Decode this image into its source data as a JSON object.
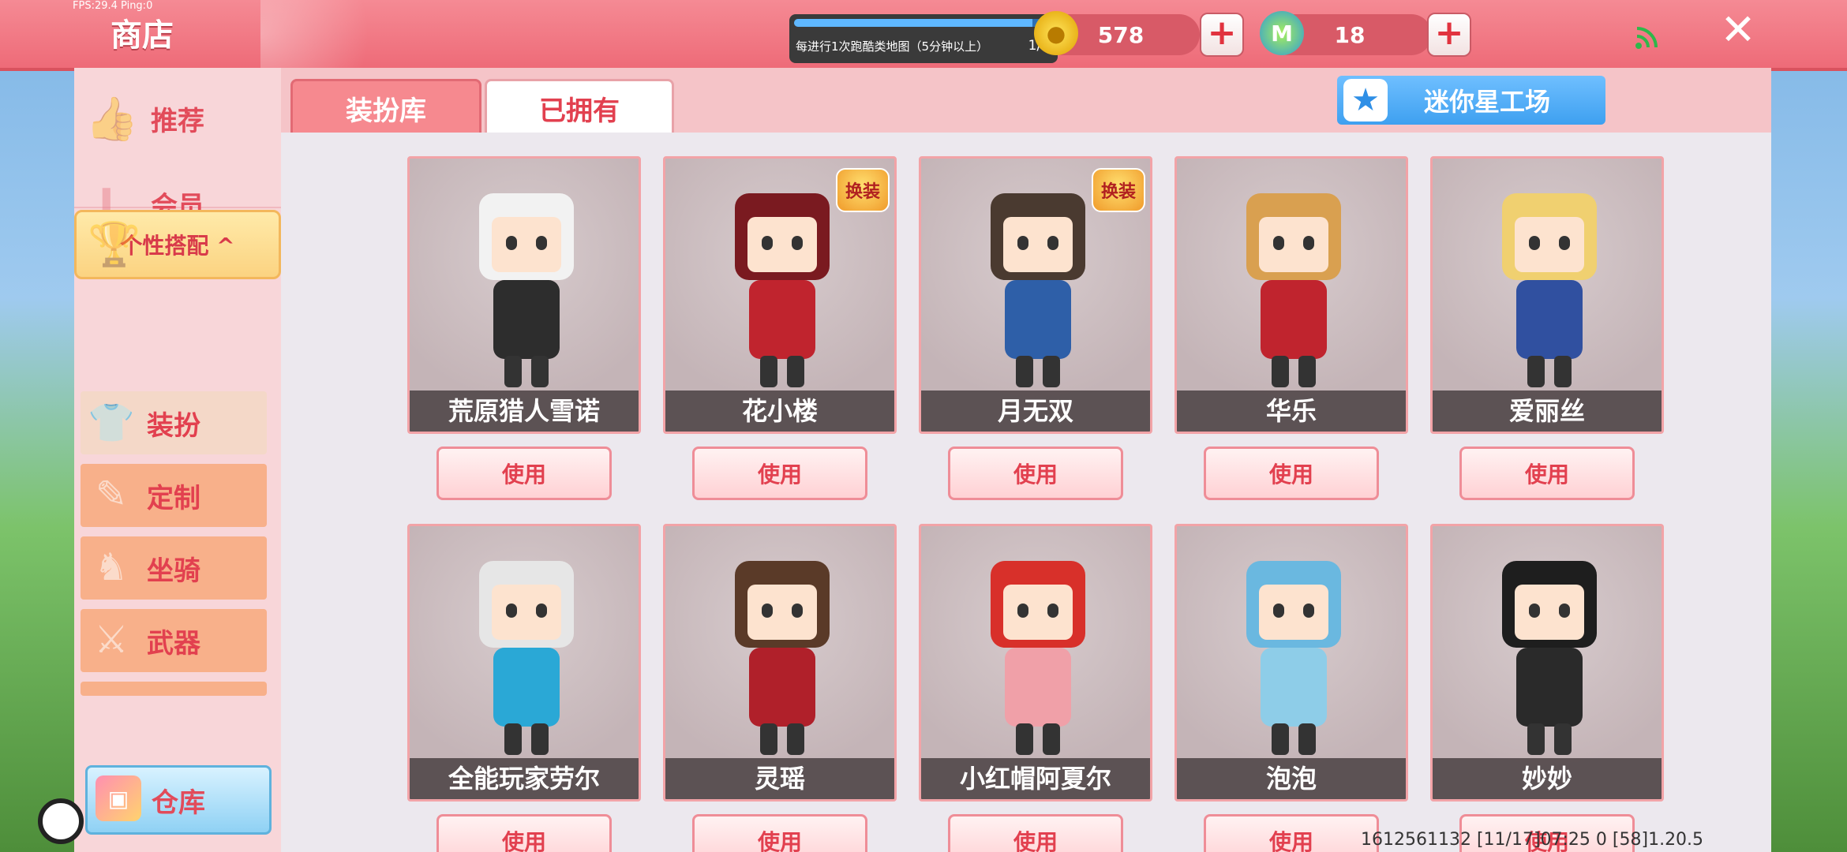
{
  "debug": {
    "fps": "FPS:29.4  Ping:0"
  },
  "header": {
    "title": "商店",
    "task": {
      "text": "每进行1次跑酷类地图（5分钟以上）",
      "count": "1/1",
      "progress": 0.92
    },
    "coins": {
      "value": "578"
    },
    "mini_coins": {
      "value": "18",
      "icon_label": "M"
    }
  },
  "colors": {
    "accent": "#ee6b78",
    "sidebar": "#f8d6d9",
    "panel": "#f5c4c8",
    "blue": "#3ea0f0"
  },
  "sidebar": {
    "items": [
      {
        "label": "推荐",
        "icon": "thumb-icon"
      },
      {
        "label": "会员",
        "icon": "vip-icon"
      },
      {
        "label": "个性搭配 ^",
        "icon": "trophy-icon"
      }
    ],
    "subitems": [
      {
        "label": "装扮",
        "icon": "shirt-icon"
      },
      {
        "label": "定制",
        "icon": "pencil-icon"
      },
      {
        "label": "坐骑",
        "icon": "horse-icon"
      },
      {
        "label": "武器",
        "icon": "gun-icon"
      }
    ],
    "warehouse": "仓库"
  },
  "tabs": [
    {
      "label": "装扮库"
    },
    {
      "label": "已拥有"
    }
  ],
  "workshop": {
    "label": "迷你星工场"
  },
  "badge_label": "换装",
  "items": [
    {
      "name": "荒原猎人雪诺",
      "button": "使用"
    },
    {
      "name": "花小楼",
      "button": "使用"
    },
    {
      "name": "月无双",
      "button": "使用"
    },
    {
      "name": "华乐",
      "button": "使用"
    },
    {
      "name": "爱丽丝",
      "button": "使用"
    },
    {
      "name": "全能玩家劳尔",
      "button": "使用"
    },
    {
      "name": "灵瑶",
      "button": "使用"
    },
    {
      "name": "小红帽阿夏尔",
      "button": "使用"
    },
    {
      "name": "泡泡",
      "button": "使用"
    },
    {
      "name": "妙妙",
      "button": "使用"
    }
  ],
  "footer": {
    "info": "1612561132    [11/17]07:25 0    [58]1.20.5"
  }
}
